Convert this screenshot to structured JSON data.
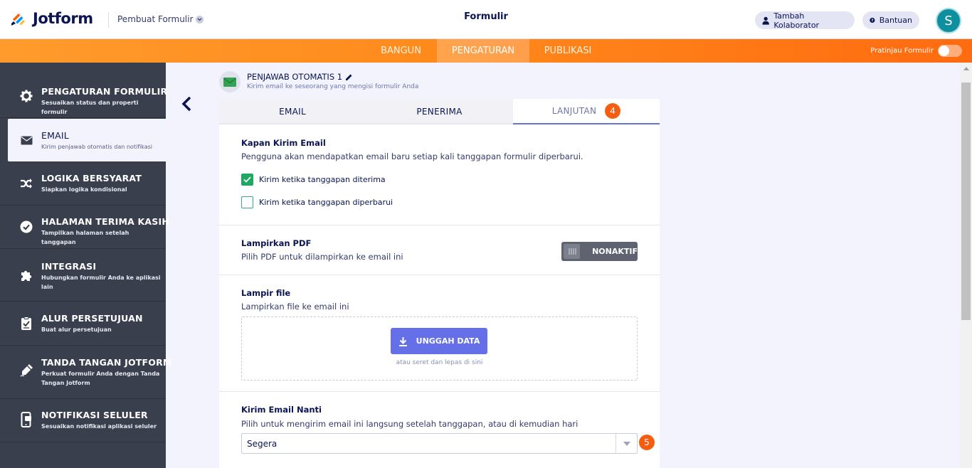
{
  "header": {
    "logo_text": "Jotform",
    "form_builder_label": "Pembuat Formulir",
    "page_title": "Formulir",
    "collaborator_label": "Tambah Kolaborator",
    "help_label": "Bantuan",
    "avatar_initial": "S"
  },
  "nav": {
    "tabs": [
      {
        "label": "BANGUN",
        "active": false
      },
      {
        "label": "PENGATURAN",
        "active": true
      },
      {
        "label": "PUBLIKASI",
        "active": false
      }
    ],
    "preview_label": "Pratinjau Formulir",
    "preview_on": false
  },
  "sidebar": {
    "items": [
      {
        "title": "PENGATURAN FORMULIR",
        "desc": "Sesuaikan status dan properti formulir",
        "icon": "gear-icon"
      },
      {
        "title": "EMAIL",
        "desc": "Kirim penjawab otomatis dan notifikasi",
        "icon": "envelope-icon",
        "active": true
      },
      {
        "title": "LOGIKA BERSYARAT",
        "desc": "Siapkan logika kondisional",
        "icon": "shuffle-icon"
      },
      {
        "title": "HALAMAN TERIMA KASIH",
        "desc": "Tampilkan halaman setelah tanggapan",
        "icon": "check-circle-icon"
      },
      {
        "title": "INTEGRASI",
        "desc": "Hubungkan formulir Anda ke aplikasi lain",
        "icon": "puzzle-icon"
      },
      {
        "title": "ALUR PERSETUJUAN",
        "desc": "Buat alur persetujuan",
        "icon": "approval-icon"
      },
      {
        "title": "TANDA TANGAN JOTFORM",
        "desc": "Perkuat formulir Anda dengan Tanda Tangan Jotform",
        "icon": "signature-pen-icon"
      },
      {
        "title": "NOTIFIKASI SELULER",
        "desc": "Sesuaikan notifikasi aplikasi seluler",
        "icon": "mobile-notification-icon"
      }
    ]
  },
  "panel": {
    "title": "PENJAWAB OTOMATIS 1",
    "subtitle": "Kirim email ke seseorang yang mengisi formulir Anda",
    "tabs": [
      {
        "label": "EMAIL",
        "active": false
      },
      {
        "label": "PENERIMA",
        "active": false
      },
      {
        "label": "LANJUTAN",
        "active": true,
        "badge": "4"
      }
    ]
  },
  "advanced": {
    "when_send": {
      "title": "Kapan Kirim Email",
      "desc": "Pengguna akan mendapatkan email baru setiap kali tanggapan formulir diperbarui.",
      "options": [
        {
          "label": "Kirim ketika tanggapan diterima",
          "checked": true
        },
        {
          "label": "Kirim ketika tanggapan diperbarui",
          "checked": false
        }
      ]
    },
    "attach_pdf": {
      "title": "Lampirkan PDF",
      "desc": "Pilih PDF untuk dilampirkan ke email ini",
      "toggle_label": "NONAKTIF"
    },
    "attach_file": {
      "title": "Lampir file",
      "desc": "Lampirkan file ke email ini",
      "upload_label": "UNGGAH DATA",
      "drop_hint": "atau seret dan lepas di sini"
    },
    "send_later": {
      "title": "Kirim Email Nanti",
      "desc": "Pilih untuk mengirim email ini langsung setelah tanggapan, atau di kemudian hari",
      "selected": "Segera",
      "badge": "5"
    }
  },
  "colors": {
    "accent_orange": "#ff6100",
    "sidebar_bg": "#3a3f4d",
    "checkbox_green": "#1fa862",
    "upload_blue": "#6570e8"
  }
}
